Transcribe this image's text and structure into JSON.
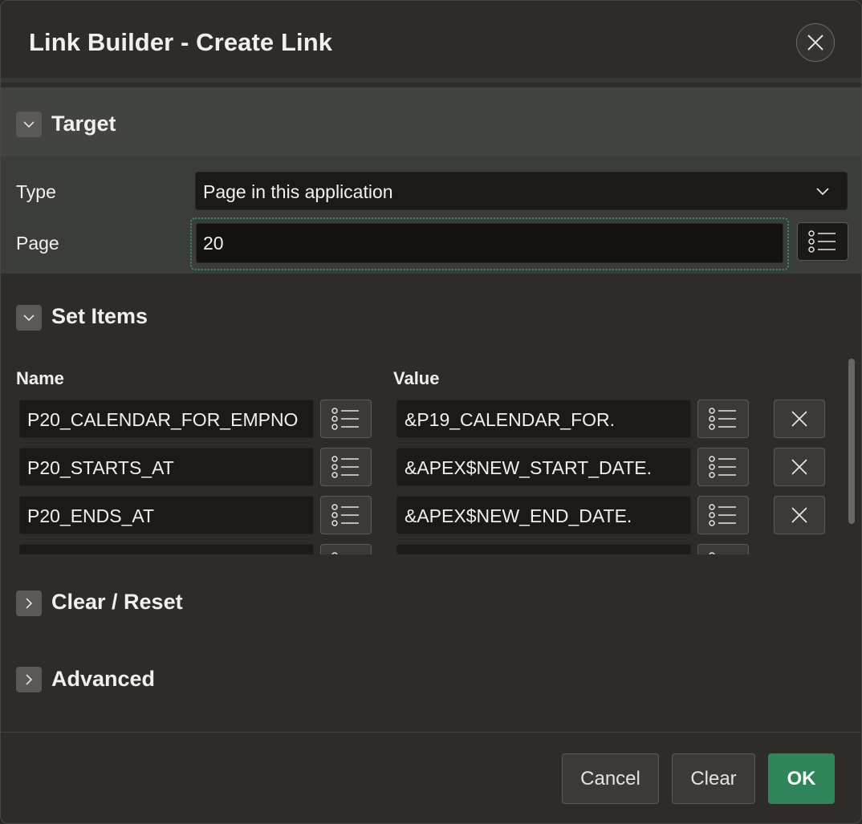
{
  "dialog": {
    "title": "Link Builder - Create Link",
    "close_icon": "close-icon"
  },
  "target": {
    "title": "Target",
    "type_label": "Type",
    "type_value": "Page in this application",
    "page_label": "Page",
    "page_value": "20"
  },
  "set_items": {
    "title": "Set Items",
    "name_header": "Name",
    "value_header": "Value",
    "rows": [
      {
        "name": "P20_CALENDAR_FOR_EMPNO",
        "value": "&P19_CALENDAR_FOR."
      },
      {
        "name": "P20_STARTS_AT",
        "value": "&APEX$NEW_START_DATE."
      },
      {
        "name": "P20_ENDS_AT",
        "value": "&APEX$NEW_END_DATE."
      },
      {
        "name": "",
        "value": ""
      }
    ]
  },
  "sections": {
    "clear_reset": "Clear / Reset",
    "advanced": "Advanced"
  },
  "footer": {
    "cancel": "Cancel",
    "clear": "Clear",
    "ok": "OK"
  },
  "colors": {
    "background": "#2e2c29",
    "target_region": "#3b3d39",
    "primary_button": "#2f8459",
    "focus_ring": "#3e8a62"
  }
}
